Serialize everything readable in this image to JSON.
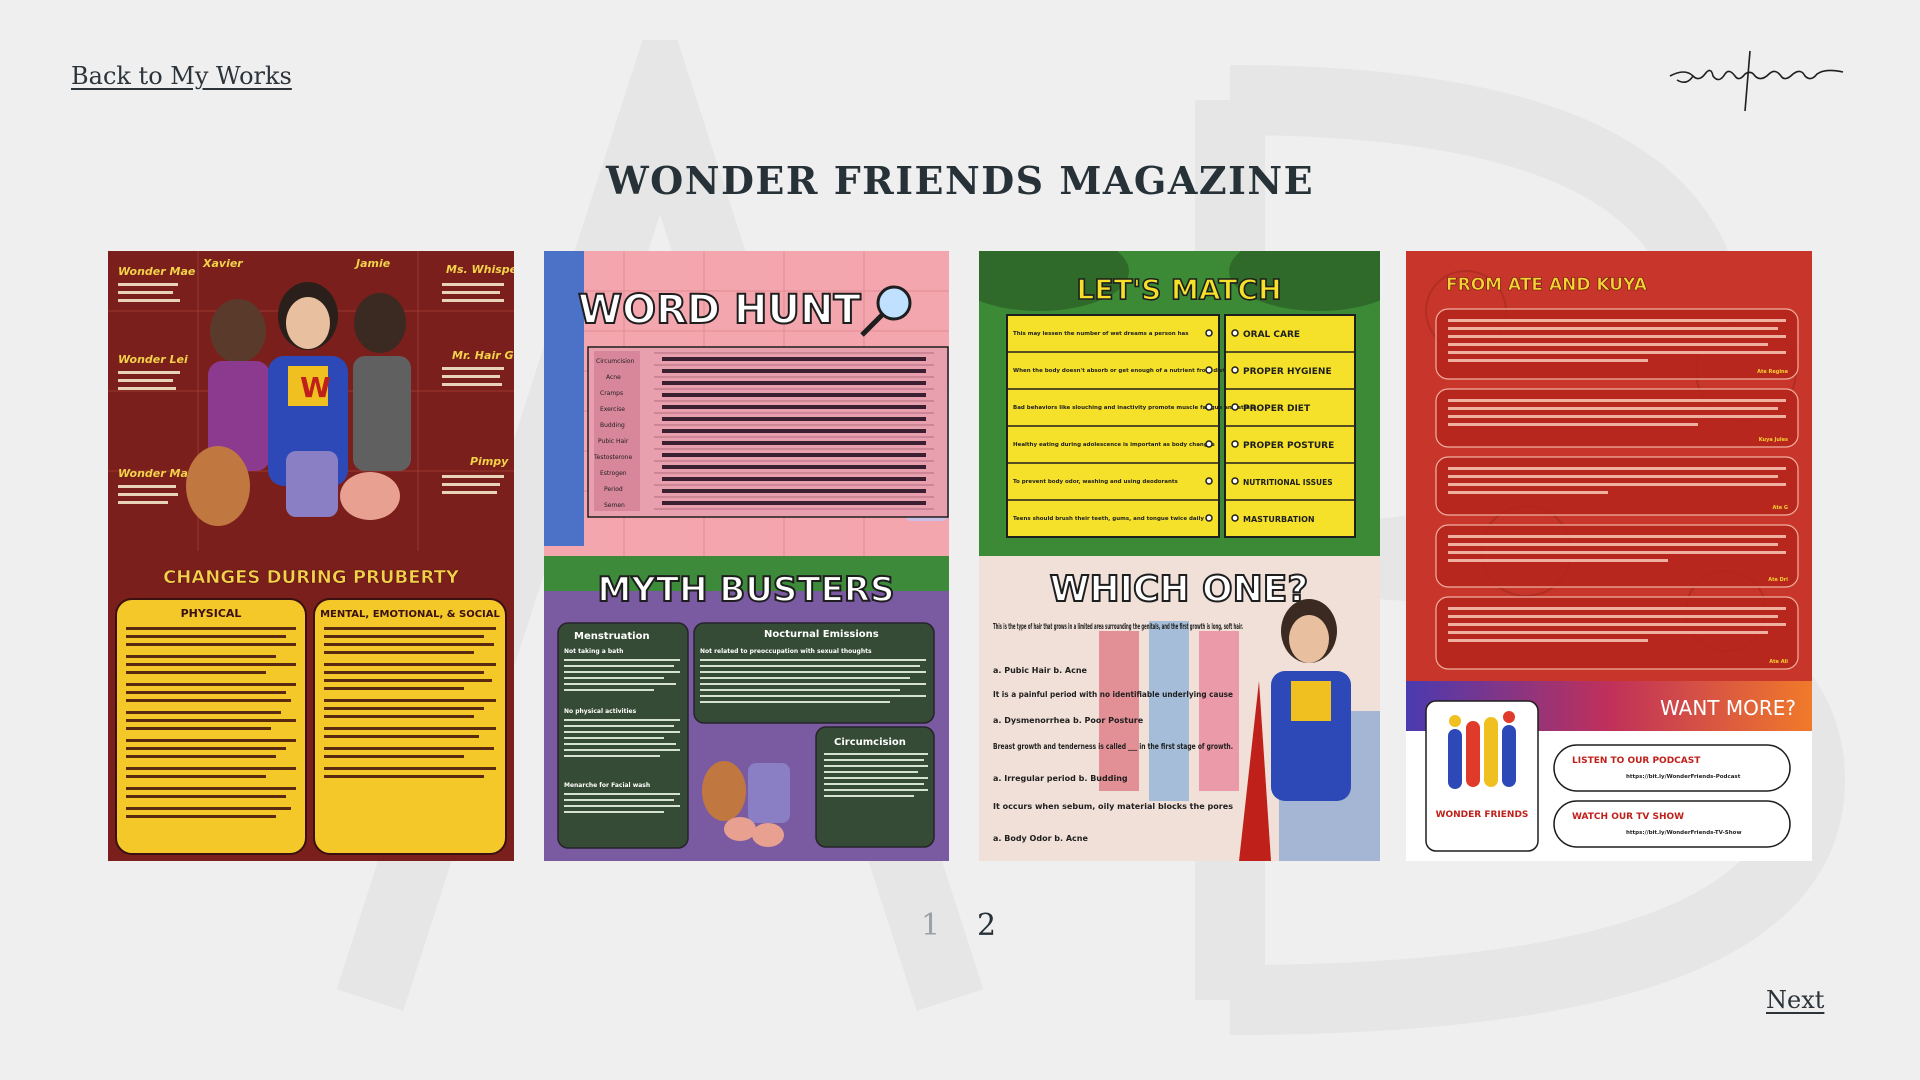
{
  "nav": {
    "back_label": "Back to My Works",
    "next_label": "Next"
  },
  "brand": {
    "signature": "adrianne"
  },
  "title": "WONDER FRIENDS MAGAZINE",
  "pagination": {
    "pages": [
      "1",
      "2"
    ],
    "current": "2"
  },
  "panels": {
    "characters": {
      "heading": "CHANGES DURING PRUBERTY",
      "names": [
        "Wonder Mae",
        "Xavier",
        "Jamie",
        "Ms. Whisper",
        "Wonder Lei",
        "Mr. Hair G",
        "Wonder Mat",
        "Pimpy"
      ],
      "col1": "PHYSICAL",
      "col2": "MENTAL, EMOTIONAL, & SOCIAL",
      "logo": "W"
    },
    "wordhunt": {
      "heading": "WORD HUNT",
      "words": [
        "Circumcision",
        "Acne",
        "Cramps",
        "Exercise",
        "Budding",
        "Pubic Hair",
        "Testosterone",
        "Estrogen",
        "Period",
        "Semen"
      ],
      "myth_heading": "MYTH BUSTERS",
      "myth_cols": [
        "Menstruation",
        "Nocturnal Emissions",
        "Circumcision"
      ],
      "myth_items": [
        "Not taking a bath",
        "Not related to preoccupation with sexual thoughts",
        "No physical activities",
        "Menarche for Facial wash"
      ]
    },
    "match": {
      "heading": "LET'S MATCH",
      "left": [
        "This may lessen the number of wet dreams a person has",
        "When the body doesn't absorb or get enough of a nutrient from diet",
        "Bad behaviors like slouching and inactivity promote muscle fatigue and stress",
        "Healthy eating during adolescence is important as body changes",
        "To prevent body odor, washing and using deodorants",
        "Teens should brush their teeth, gums, and tongue twice daily"
      ],
      "right": [
        "ORAL CARE",
        "PROPER HYGIENE",
        "PROPER DIET",
        "PROPER POSTURE",
        "NUTRITIONAL ISSUES",
        "MASTURBATION"
      ],
      "which_heading": "WHICH ONE?",
      "which_lines": [
        "This is the type of hair that grows in a limited area surrounding the genitals, and the first growth is long, soft hair.",
        "a. Pubic Hair   b. Acne",
        "It is a painful period with no identifiable underlying cause",
        "a. Dysmenorrhea   b. Poor Posture",
        "Breast growth and tenderness is called ___ in the first stage of growth.",
        "a. Irregular period   b. Budding",
        "It occurs when sebum, oily material blocks the pores",
        "a. Body Odor   b. Acne"
      ]
    },
    "ate_kuya": {
      "heading": "FROM ATE AND KUYA",
      "signatures": [
        "Ate Regine",
        "Kuya Jules",
        "Ate G",
        "Ate Dri",
        "Ate Ali"
      ],
      "want_more": "WANT MORE?",
      "podcast_label": "LISTEN TO OUR PODCAST",
      "podcast_url": "https://bit.ly/WonderFriends-Podcast",
      "tv_label": "WATCH OUR TV SHOW",
      "tv_url": "https://bit.ly/WonderFriends-TV-Show",
      "logo_text": "WONDER FRIENDS"
    }
  }
}
